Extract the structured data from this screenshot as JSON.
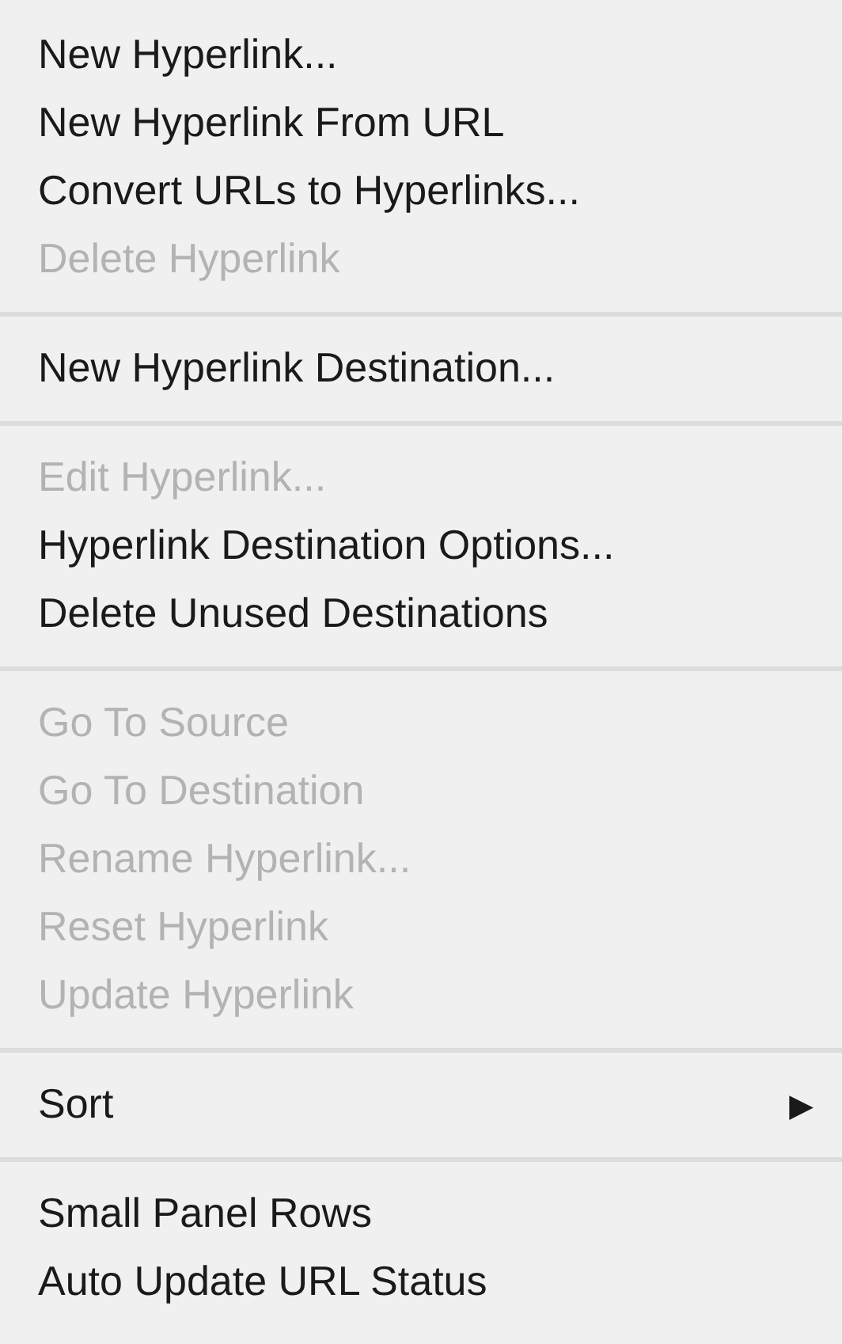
{
  "menu": {
    "sections": [
      {
        "items": [
          {
            "label": "New Hyperlink...",
            "disabled": false
          },
          {
            "label": "New Hyperlink From URL",
            "disabled": false
          },
          {
            "label": "Convert URLs to Hyperlinks...",
            "disabled": false
          },
          {
            "label": "Delete Hyperlink",
            "disabled": true
          }
        ]
      },
      {
        "items": [
          {
            "label": "New Hyperlink Destination...",
            "disabled": false
          }
        ]
      },
      {
        "items": [
          {
            "label": "Edit Hyperlink...",
            "disabled": true
          },
          {
            "label": "Hyperlink Destination Options...",
            "disabled": false
          },
          {
            "label": "Delete Unused Destinations",
            "disabled": false
          }
        ]
      },
      {
        "items": [
          {
            "label": "Go To Source",
            "disabled": true
          },
          {
            "label": "Go To Destination",
            "disabled": true
          },
          {
            "label": "Rename Hyperlink...",
            "disabled": true
          },
          {
            "label": "Reset Hyperlink",
            "disabled": true
          },
          {
            "label": "Update Hyperlink",
            "disabled": true
          }
        ]
      },
      {
        "items": [
          {
            "label": "Sort",
            "disabled": false,
            "submenu_arrow": "▶"
          }
        ]
      },
      {
        "items": [
          {
            "label": "Small Panel Rows",
            "disabled": false
          },
          {
            "label": "Auto Update URL Status",
            "disabled": false
          }
        ]
      }
    ]
  }
}
